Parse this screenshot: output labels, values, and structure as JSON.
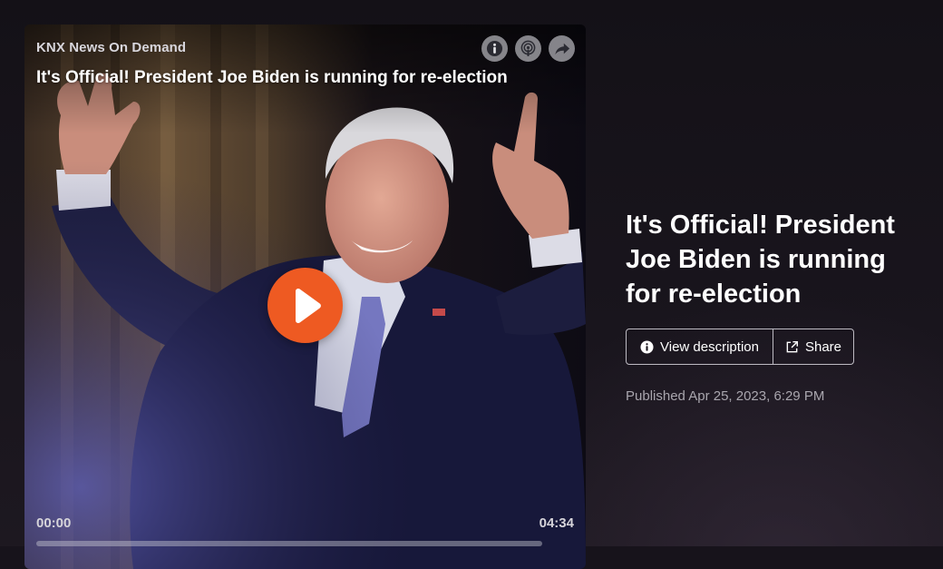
{
  "player": {
    "source": "KNX News On Demand",
    "episode_title": "It's Official! President Joe Biden is running for re-election",
    "time_current": "00:00",
    "time_total": "04:34",
    "progress": 0,
    "icons": [
      "info-icon",
      "podcast-icon",
      "share-arrow-icon",
      "play-icon"
    ],
    "play_color": "#ee5a22"
  },
  "info": {
    "title": "It's Official! President Joe Biden is running for re-election",
    "view_description": "View description",
    "share": "Share",
    "published": "Published Apr 25, 2023, 6:29 PM"
  }
}
